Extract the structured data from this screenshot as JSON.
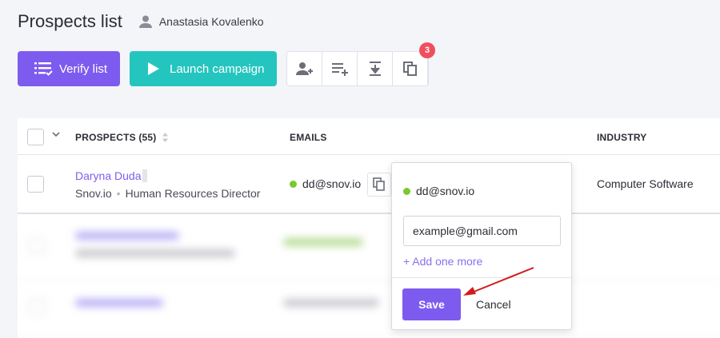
{
  "header": {
    "title": "Prospects list",
    "owner": "Anastasia Kovalenko"
  },
  "toolbar": {
    "verify_label": "Verify list",
    "launch_label": "Launch campaign",
    "icon_buttons": [
      "add-prospect-icon",
      "add-to-list-icon",
      "export-icon",
      "duplicates-icon"
    ],
    "duplicates_badge": "3"
  },
  "table": {
    "headers": {
      "prospects": "PROSPECTS (55)",
      "emails": "EMAILS",
      "industry": "INDUSTRY"
    },
    "rows": [
      {
        "name": "Daryna Duda",
        "company": "Snov.io",
        "separator": "•",
        "position": "Human Resources Director",
        "email": "dd@snov.io",
        "industry": "Computer Software"
      }
    ]
  },
  "popover": {
    "email": "dd@snov.io",
    "input_value": "example@gmail.com",
    "add_more": "+ Add one more",
    "save_label": "Save",
    "cancel_label": "Cancel"
  },
  "colors": {
    "accent": "#7e5bef",
    "teal": "#25c5bf",
    "badge": "#ef4f5e",
    "valid": "#7ac92d",
    "annotation": "#d21a1a"
  }
}
